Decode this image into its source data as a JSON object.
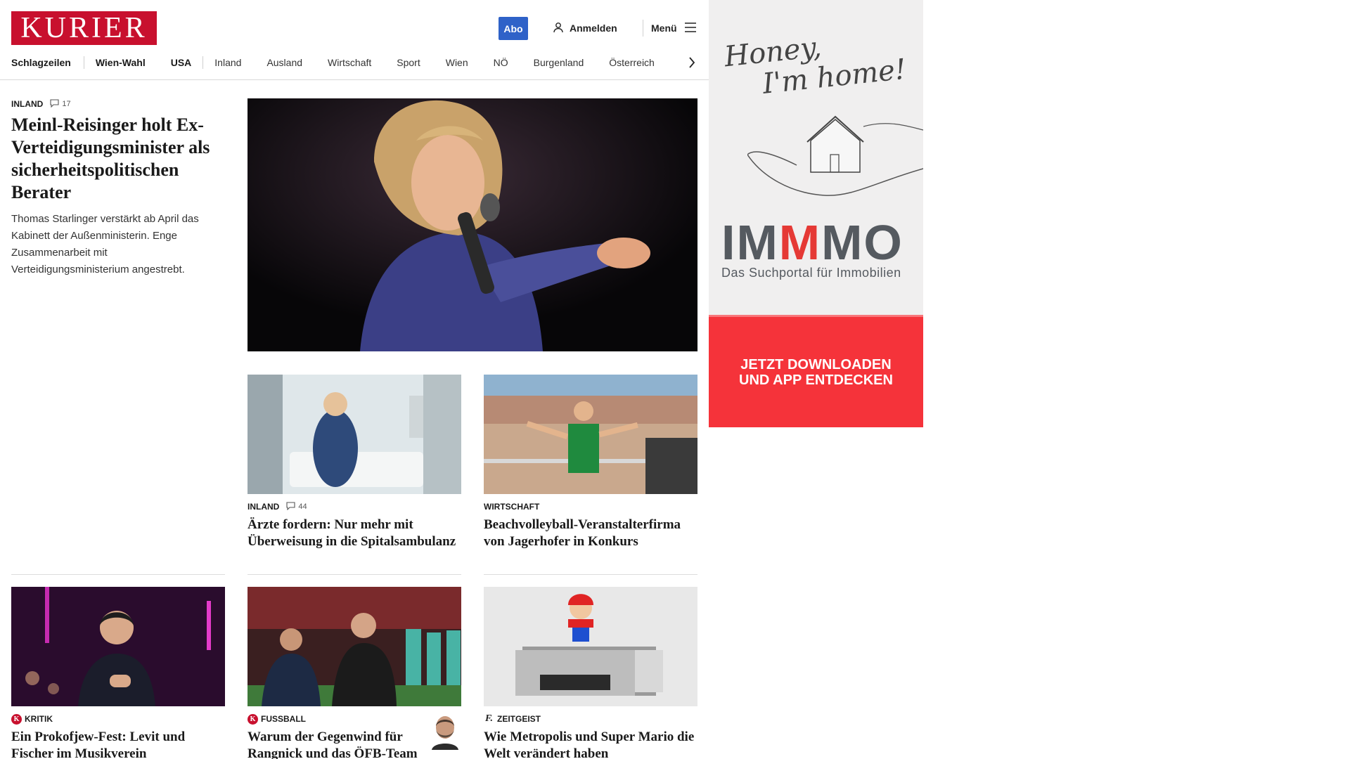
{
  "header": {
    "logo": "KURIER",
    "abo_label": "Abo",
    "login_label": "Anmelden",
    "menu_label": "Menü"
  },
  "nav": {
    "items": [
      "Schlagzeilen",
      "Wien-Wahl",
      "USA",
      "Inland",
      "Ausland",
      "Wirtschaft",
      "Sport",
      "Wien",
      "NÖ",
      "Burgenland",
      "Österreich"
    ]
  },
  "lead": {
    "kicker": "INLAND",
    "comments": "17",
    "title": "Meinl-Reisinger holt Ex-Verteidigungsminister als sicherheitspolitischen Berater",
    "teaser": "Thomas Starlinger verstärkt ab April das Kabinett der Außenministerin. Enge Zusammenarbeit mit Verteidigungsministerium angestrebt."
  },
  "cards": [
    {
      "kicker": "INLAND",
      "comments": "44",
      "title": "Ärzte fordern: Nur mehr mit Überweisung in die Spitalsambulanz"
    },
    {
      "kicker": "WIRTSCHAFT",
      "title": "Beachvolleyball-Veranstalterfirma von Jagerhofer in Konkurs"
    },
    {
      "kicker": "KRITIK",
      "badge": "K",
      "title": "Ein Prokofjew-Fest: Levit und Fischer im Musikverein"
    },
    {
      "kicker": "FUSSBALL",
      "badge": "K",
      "title": "Warum der Gegenwind für Rangnick und das ÖFB-Team ein Lüftchen ist"
    },
    {
      "kicker": "ZEITGEIST",
      "badge": "f.",
      "title": "Wie Metropolis und Super Mario die Welt verändert haben"
    }
  ],
  "ad": {
    "headline_line1": "Honey,",
    "headline_line2": "I'm home!",
    "brand_a": "IM",
    "brand_b": "M",
    "brand_c": "MO",
    "subline": "Das Suchportal für Immobilien",
    "cta": "JETZT DOWNLOADEN UND APP ENTDECKEN"
  },
  "colors": {
    "brand_red": "#c8102e",
    "abo_blue": "#2f62c8",
    "ad_red": "#f5333a"
  }
}
